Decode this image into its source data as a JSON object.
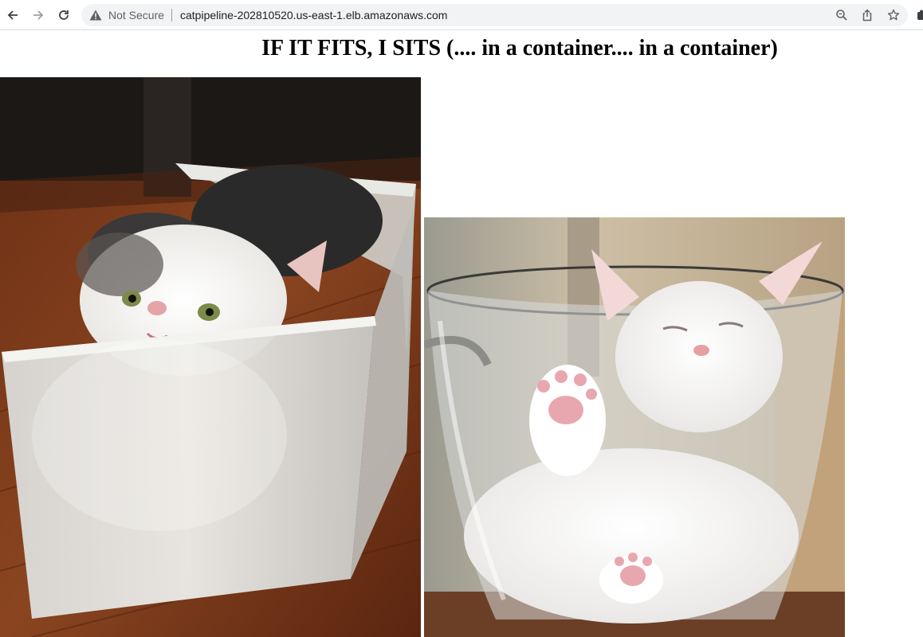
{
  "browser": {
    "security_label": "Not Secure",
    "url": "catpipeline-202810520.us-east-1.elb.amazonaws.com",
    "nav_icons": [
      "back-arrow-icon",
      "forward-arrow-icon",
      "reload-icon"
    ],
    "omnibox_icons": [
      "warning-icon",
      "zoom-icon",
      "share-icon",
      "bookmark-star-icon"
    ]
  },
  "page": {
    "title": "IF IT FITS, I SITS (.... in a container.... in a container)",
    "images": [
      {
        "name": "cat-in-plastic-bin-photo"
      },
      {
        "name": "cat-in-glass-bowl-photo"
      }
    ]
  },
  "colors": {
    "omnibox_bg": "#f1f3f4",
    "floor_wood": "#7a3a1c",
    "wall_beige": "#c9b69a"
  }
}
